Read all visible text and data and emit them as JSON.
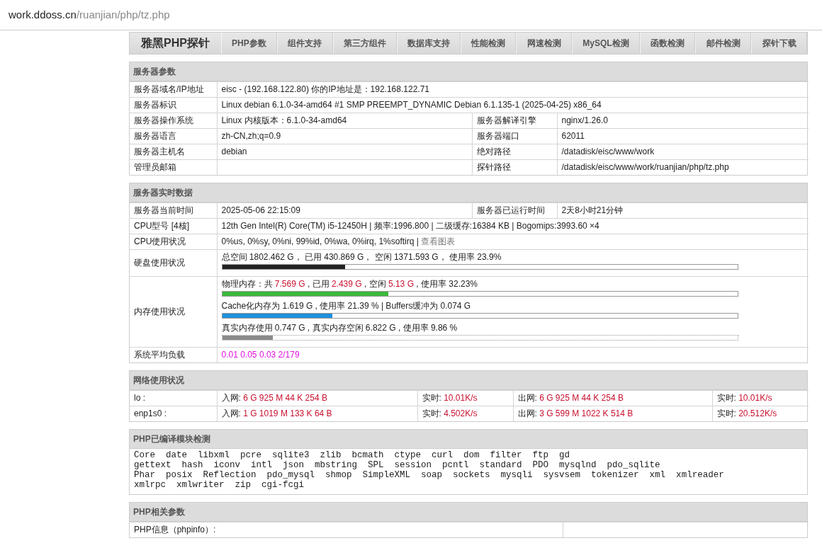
{
  "address_bar": {
    "host": "work.ddoss.cn",
    "path": "/ruanjian/php/tz.php"
  },
  "nav": {
    "brand": "雅黑PHP探针",
    "items": [
      "PHP参数",
      "组件支持",
      "第三方组件",
      "数据库支持",
      "性能检测",
      "网速检测",
      "MySQL检测",
      "函数检测",
      "邮件检测",
      "探针下载"
    ]
  },
  "server_params": {
    "title": "服务器参数",
    "rows": [
      {
        "cells": [
          {
            "label": "服务器域名/IP地址",
            "value": "eisc - (192.168.122.80)  你的IP地址是：192.168.122.71"
          }
        ]
      },
      {
        "cells": [
          {
            "label": "服务器标识",
            "value": "Linux debian 6.1.0-34-amd64 #1 SMP PREEMPT_DYNAMIC Debian 6.1.135-1 (2025-04-25) x86_64"
          }
        ]
      },
      {
        "cells": [
          {
            "label": "服务器操作系统",
            "value": "Linux  内核版本：6.1.0-34-amd64"
          },
          {
            "label": "服务器解译引擎",
            "value": "nginx/1.26.0"
          }
        ]
      },
      {
        "cells": [
          {
            "label": "服务器语言",
            "value": "zh-CN,zh;q=0.9"
          },
          {
            "label": "服务器端口",
            "value": "62011"
          }
        ]
      },
      {
        "cells": [
          {
            "label": "服务器主机名",
            "value": "debian"
          },
          {
            "label": "绝对路径",
            "value": "/datadisk/eisc/www/work"
          }
        ]
      },
      {
        "cells": [
          {
            "label": "管理员邮箱"
          },
          {
            "label": "探针路径",
            "value": "/datadisk/eisc/www/work/ruanjian/php/tz.php"
          }
        ]
      }
    ]
  },
  "realtime": {
    "title": "服务器实时数据",
    "rows": [
      {
        "cells": [
          {
            "label": "服务器当前时间",
            "value": "2025-05-06 22:15:09"
          },
          {
            "label": "服务器已运行时间",
            "value": "2天8小时21分钟"
          }
        ]
      },
      {
        "cells": [
          {
            "label": "CPU型号 [4核]",
            "value": "12th Gen Intel(R) Core(TM) i5-12450H | 频率:1996.800 | 二级缓存:16384 KB | Bogomips:3993.60 ×4"
          }
        ]
      },
      {
        "cells": [
          {
            "label": "CPU使用状况",
            "parts": [
              {
                "text": "0%us, 0%sy, 0%ni, 99%id, 0%wa, 0%irq, 1%softirq | ",
                "kind": "plain"
              },
              {
                "text": "查看图表",
                "kind": "link"
              }
            ]
          }
        ]
      },
      {
        "cells": [
          {
            "label": "硬盘使用状况",
            "meters": [
              {
                "parts": [
                  {
                    "text": "总空间 1802.462 G， 已用 430.869 G， 空闲 1371.593 G， 使用率 23.9%",
                    "kind": "plain"
                  }
                ],
                "level": 0.239,
                "color": "#222222",
                "dotted": false
              }
            ]
          }
        ]
      },
      {
        "cells": [
          {
            "label": "内存使用状况",
            "meters": [
              {
                "parts": [
                  {
                    "text": "物理内存：共 ",
                    "kind": "plain"
                  },
                  {
                    "text": "7.569 G",
                    "kind": "red"
                  },
                  {
                    "text": " , 已用 ",
                    "kind": "plain"
                  },
                  {
                    "text": "2.439 G",
                    "kind": "red"
                  },
                  {
                    "text": " , 空闲 ",
                    "kind": "plain"
                  },
                  {
                    "text": "5.13 G",
                    "kind": "red"
                  },
                  {
                    "text": " , 使用率 32.23%",
                    "kind": "plain"
                  }
                ],
                "level": 0.3223,
                "color": "#3cb83c",
                "dotted": false
              },
              {
                "parts": [
                  {
                    "text": "Cache化内存为 1.619 G , 使用率 21.39 % | Buffers缓冲为 0.074 G",
                    "kind": "plain"
                  }
                ],
                "level": 0.2139,
                "color": "#1e90dc",
                "dotted": false
              },
              {
                "parts": [
                  {
                    "text": "真实内存使用 0.747 G , 真实内存空闲 6.822 G , 使用率 9.86 %",
                    "kind": "plain"
                  }
                ],
                "level": 0.0986,
                "color": "#8a8a8a",
                "dotted": true
              }
            ]
          }
        ]
      },
      {
        "cells": [
          {
            "label": "系统平均负载",
            "parts": [
              {
                "text": "0.01 0.05 0.03 2/179",
                "kind": "magenta"
              }
            ]
          }
        ]
      }
    ]
  },
  "network": {
    "title": "网络使用状况",
    "rows": [
      {
        "name": "lo :",
        "cells": [
          [
            {
              "text": "入网: ",
              "kind": "plain"
            },
            {
              "text": "6 G 925 M 44 K 254 B",
              "kind": "red"
            }
          ],
          [
            {
              "text": "实时: ",
              "kind": "plain"
            },
            {
              "text": "10.01K/s",
              "kind": "red"
            }
          ],
          [
            {
              "text": "出网: ",
              "kind": "plain"
            },
            {
              "text": "6 G 925 M 44 K 254 B",
              "kind": "red"
            }
          ],
          [
            {
              "text": "实时: ",
              "kind": "plain"
            },
            {
              "text": "10.01K/s",
              "kind": "red"
            }
          ]
        ]
      },
      {
        "name": "enp1s0 :",
        "cells": [
          [
            {
              "text": "入网: ",
              "kind": "plain"
            },
            {
              "text": "1 G 1019 M 133 K 64 B",
              "kind": "red"
            }
          ],
          [
            {
              "text": "实时: ",
              "kind": "plain"
            },
            {
              "text": "4.502K/s",
              "kind": "red"
            }
          ],
          [
            {
              "text": "出网: ",
              "kind": "plain"
            },
            {
              "text": "3 G 599 M 1022 K 514 B",
              "kind": "red"
            }
          ],
          [
            {
              "text": "实时: ",
              "kind": "plain"
            },
            {
              "text": "20.512K/s",
              "kind": "red"
            }
          ]
        ]
      }
    ]
  },
  "modules": {
    "title": "PHP已编译模块检测",
    "lines": [
      "Core  date  libxml  pcre  sqlite3  zlib  bcmath  ctype  curl  dom  filter  ftp  gd",
      "gettext  hash  iconv  intl  json  mbstring  SPL  session  pcntl  standard  PDO  mysqlnd  pdo_sqlite",
      "Phar  posix  Reflection  pdo_mysql  shmop  SimpleXML  soap  sockets  mysqli  sysvsem  tokenizer  xml  xmlreader",
      "xmlrpc  xmlwriter  zip  cgi-fcgi"
    ]
  },
  "php_params": {
    "title": "PHP相关参数",
    "rows": [
      {
        "label": "PHP信息（phpinfo）:"
      }
    ]
  }
}
